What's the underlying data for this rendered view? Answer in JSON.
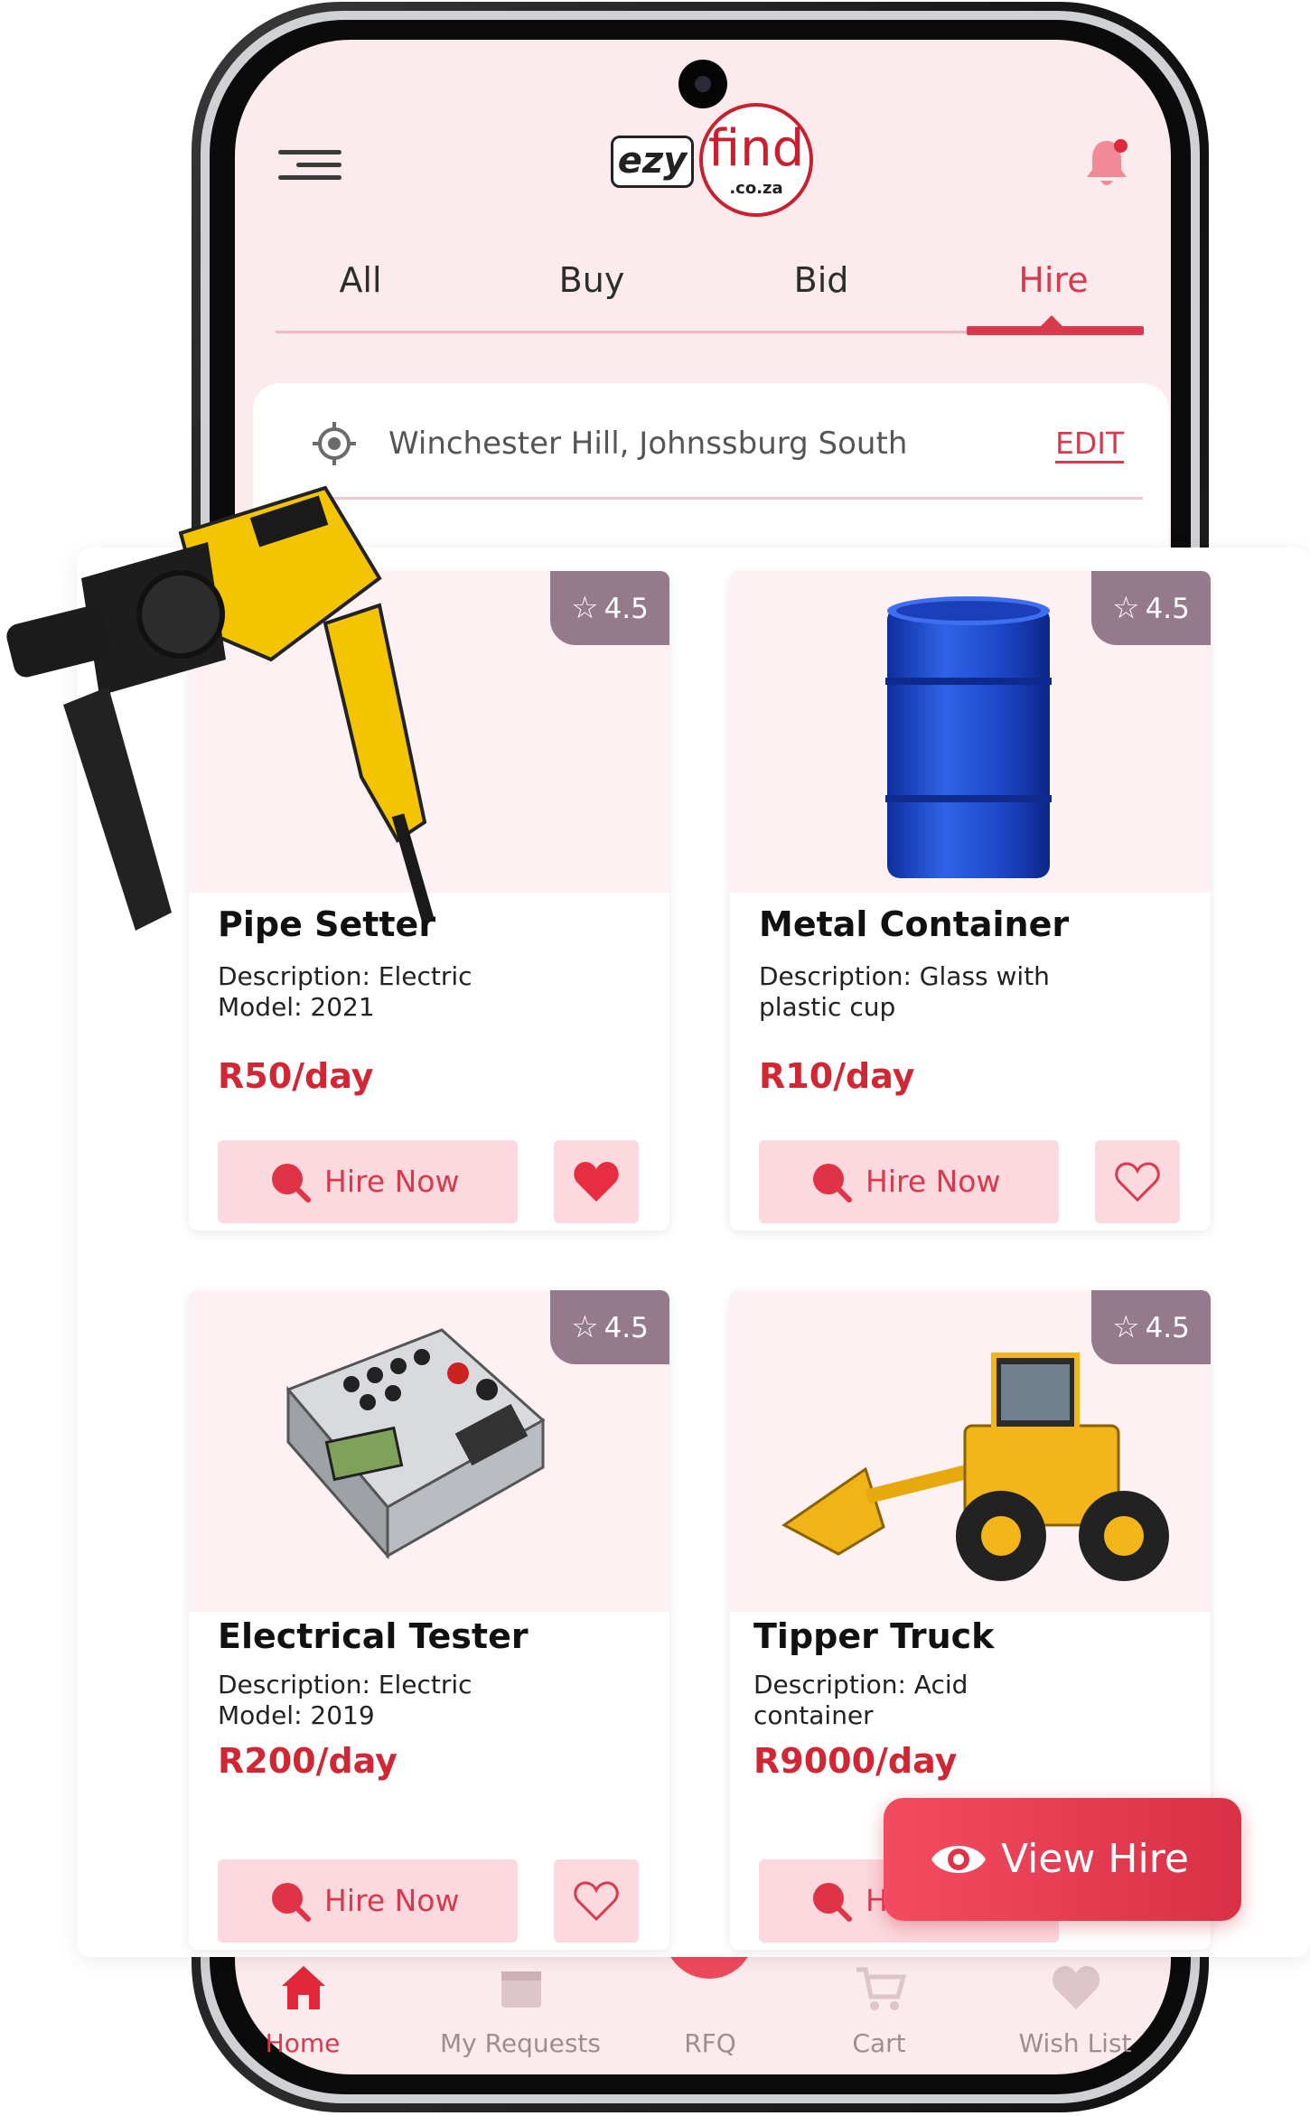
{
  "header": {
    "logo_left": "ezy",
    "logo_right": "find",
    "logo_domain": ".co.za"
  },
  "tabs": [
    {
      "label": "All",
      "active": false
    },
    {
      "label": "Buy",
      "active": false
    },
    {
      "label": "Bid",
      "active": false
    },
    {
      "label": "Hire",
      "active": true
    }
  ],
  "location": {
    "address": "Winchester Hill, Johnssburg South",
    "edit_label": "EDIT"
  },
  "products": [
    {
      "name": "Pipe Setter",
      "description_line1": "Description: Electric",
      "description_line2": "Model: 2021",
      "price": "R50/day",
      "rating": "4.5",
      "hire_label": "Hire Now",
      "favorited": true,
      "image": "power-drill"
    },
    {
      "name": "Metal Container",
      "description_line1": "Description: Glass with",
      "description_line2": "plastic cup",
      "price": "R10/day",
      "rating": "4.5",
      "hire_label": "Hire Now",
      "favorited": false,
      "image": "blue-barrel"
    },
    {
      "name": "Electrical Tester",
      "description_line1": "Description: Electric",
      "description_line2": "Model: 2019",
      "price": "R200/day",
      "rating": "4.5",
      "hire_label": "Hire Now",
      "favorited": false,
      "image": "electrical-tester"
    },
    {
      "name": "Tipper Truck",
      "description_line1": "Description: Acid",
      "description_line2": "container",
      "price": "R9000/day",
      "rating": "4.5",
      "hire_label": "Hire Now",
      "favorited": false,
      "image": "wheel-loader"
    }
  ],
  "view_hire": {
    "label": "View Hire"
  },
  "bottom_nav": [
    {
      "label": "Home",
      "icon": "home-icon",
      "active": true
    },
    {
      "label": "My Requests",
      "icon": "box-icon",
      "active": false
    },
    {
      "label": "RFQ",
      "icon": "rfq-icon",
      "active": false
    },
    {
      "label": "Cart",
      "icon": "cart-icon",
      "active": false
    },
    {
      "label": "Wish List",
      "icon": "heart-icon",
      "active": false
    }
  ],
  "colors": {
    "accent": "#d8394d",
    "price": "#d12735",
    "rating_badge": "#957a8c",
    "screen_bg": "#fcebed",
    "button_bg": "#fbd9de"
  }
}
